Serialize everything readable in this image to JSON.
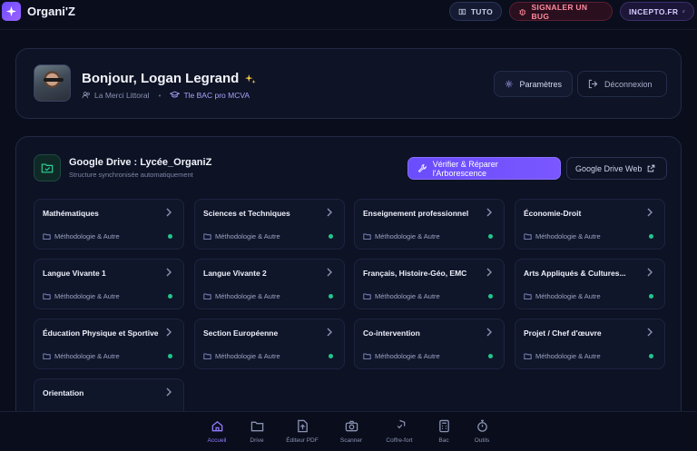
{
  "app": {
    "name": "Organi'Z",
    "links": {
      "tuto": "TUTO",
      "bug": "SIGNALER UN BUG",
      "incepto": "INCEPTO.FR"
    }
  },
  "profile": {
    "greeting": "Bonjour, Logan Legrand",
    "school": "La Merci Littoral",
    "separator": "•",
    "class_name": "Tle BAC pro MCVA",
    "settings_label": "Paramètres",
    "logout_label": "Déconnexion"
  },
  "drive": {
    "title": "Google Drive : Lycée_OrganiZ",
    "subtitle": "Structure synchronisée automatiquement",
    "repair_label": "Vérifier & Réparer l'Arborescence",
    "web_label": "Google Drive Web",
    "subjects": [
      {
        "name": "Mathématiques",
        "sub": "Méthodologie & Autre"
      },
      {
        "name": "Sciences et Techniques",
        "sub": "Méthodologie & Autre"
      },
      {
        "name": "Enseignement professionnel",
        "sub": "Méthodologie & Autre"
      },
      {
        "name": "Économie-Droit",
        "sub": "Méthodologie & Autre"
      },
      {
        "name": "Langue Vivante 1",
        "sub": "Méthodologie & Autre"
      },
      {
        "name": "Langue Vivante 2",
        "sub": "Méthodologie & Autre"
      },
      {
        "name": "Français, Histoire-Géo, EMC",
        "sub": "Méthodologie & Autre"
      },
      {
        "name": "Arts Appliqués & Cultures...",
        "sub": "Méthodologie & Autre"
      },
      {
        "name": "Éducation Physique et Sportive",
        "sub": "Méthodologie & Autre"
      },
      {
        "name": "Section Européenne",
        "sub": "Méthodologie & Autre"
      },
      {
        "name": "Co-intervention",
        "sub": "Méthodologie & Autre"
      },
      {
        "name": "Projet / Chef d'œuvre",
        "sub": "Méthodologie & Autre"
      },
      {
        "name": "Orientation",
        "sub": ""
      }
    ]
  },
  "nav": [
    {
      "label": "Accueil",
      "icon": "home-icon",
      "active": true
    },
    {
      "label": "Drive",
      "icon": "folder-icon",
      "active": false
    },
    {
      "label": "Éditeur PDF",
      "icon": "file-upload-icon",
      "active": false
    },
    {
      "label": "Scanner",
      "icon": "camera-icon",
      "active": false
    },
    {
      "label": "Coffre-fort",
      "icon": "shield-check-icon",
      "active": false
    },
    {
      "label": "Bac",
      "icon": "calculator-icon",
      "active": false
    },
    {
      "label": "Outils",
      "icon": "stopwatch-icon",
      "active": false
    }
  ],
  "colors": {
    "background": "#0a0e1c",
    "accent": "#7a57ff",
    "status_green": "#22c58b",
    "bug_red": "#ff8b9e"
  }
}
